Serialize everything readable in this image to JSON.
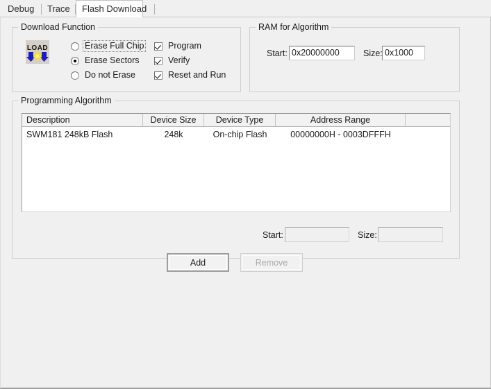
{
  "tabs": [
    {
      "label": "Debug",
      "active": false
    },
    {
      "label": "Trace",
      "active": false
    },
    {
      "label": "Flash Download",
      "active": true
    }
  ],
  "download_function": {
    "title": "Download Function",
    "icon_label": "LOAD",
    "erase_options": [
      {
        "label": "Erase Full Chip",
        "checked": false,
        "focused": true
      },
      {
        "label": "Erase Sectors",
        "checked": true,
        "focused": false
      },
      {
        "label": "Do not Erase",
        "checked": false,
        "focused": false
      }
    ],
    "action_options": [
      {
        "label": "Program",
        "checked": true
      },
      {
        "label": "Verify",
        "checked": true
      },
      {
        "label": "Reset and Run",
        "checked": true
      }
    ]
  },
  "ram_for_algorithm": {
    "title": "RAM for Algorithm",
    "start_label": "Start:",
    "start_value": "0x20000000",
    "size_label": "Size:",
    "size_value": "0x1000"
  },
  "programming_algorithm": {
    "title": "Programming Algorithm",
    "columns": [
      "Description",
      "Device Size",
      "Device Type",
      "Address Range",
      ""
    ],
    "rows": [
      {
        "description": "SWM181 248kB Flash",
        "device_size": "248k",
        "device_type": "On-chip Flash",
        "address_range": "00000000H - 0003DFFFH"
      }
    ],
    "start_label": "Start:",
    "start_value": "",
    "size_label": "Size:",
    "size_value": ""
  },
  "buttons": {
    "add": "Add",
    "remove": "Remove"
  }
}
